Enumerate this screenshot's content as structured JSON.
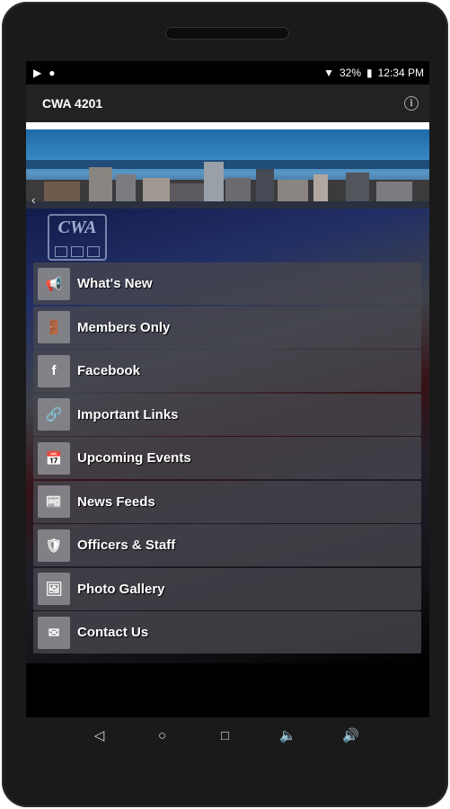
{
  "status": {
    "battery": "32%",
    "time": "12:34 PM"
  },
  "appbar": {
    "title": "CWA 4201"
  },
  "logo": {
    "text": "CWA"
  },
  "menu": [
    {
      "label": "What's New",
      "icon": "megaphone-icon",
      "glyph": "📢"
    },
    {
      "label": "Members Only",
      "icon": "door-exit-icon",
      "glyph": "🚪"
    },
    {
      "label": "Facebook",
      "icon": "facebook-icon",
      "glyph": "f"
    },
    {
      "label": "Important Links",
      "icon": "link-icon",
      "glyph": "🔗"
    },
    {
      "label": "Upcoming Events",
      "icon": "calendar-icon",
      "glyph": "📅"
    },
    {
      "label": "News Feeds",
      "icon": "news-icon",
      "glyph": "📰"
    },
    {
      "label": "Officers & Staff",
      "icon": "badge-icon",
      "glyph": "🛡"
    },
    {
      "label": "Photo Gallery",
      "icon": "photo-icon",
      "glyph": "🖼"
    },
    {
      "label": "Contact Us",
      "icon": "envelope-icon",
      "glyph": "✉"
    }
  ]
}
